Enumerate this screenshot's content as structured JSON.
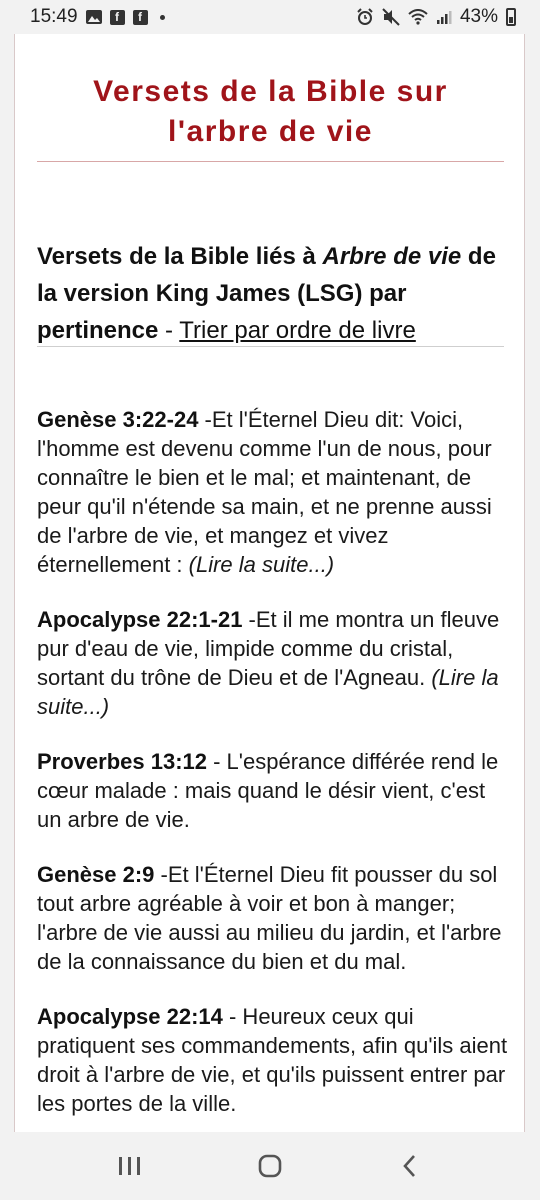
{
  "status_bar": {
    "time": "15:49",
    "battery": "43%",
    "left_icons": [
      "image-icon",
      "facebook-icon",
      "facebook-icon",
      "dot-icon"
    ],
    "right_icons": [
      "alarm-icon",
      "mute-icon",
      "wifi-icon",
      "signal-icon",
      "battery-icon"
    ]
  },
  "page": {
    "title_line1": "Versets de la Bible sur",
    "title_line2": "l'arbre de vie",
    "subhead": {
      "part1": "Versets de la Bible liés à ",
      "topic": "Arbre de vie",
      "part2": " de la version King James (LSG) par pertinence",
      "sep": " - ",
      "sort_link": "Trier par ordre de livre"
    }
  },
  "verses": [
    {
      "ref": "Genèse 3:22-24",
      "text": " -Et l'Éternel Dieu dit: Voici, l'homme est devenu comme l'un de nous, pour connaître le bien et le mal; et maintenant, de peur qu'il n'étende sa main, et ne prenne aussi de l'arbre de vie, et mangez et vivez éternellement :   ",
      "more": "(Lire la suite...)"
    },
    {
      "ref": "Apocalypse 22:1-21",
      "text": " -Et il me montra un fleuve pur d'eau de vie, limpide comme du cristal, sortant du trône de Dieu et de l'Agneau.   ",
      "more": "(Lire la suite...)"
    },
    {
      "ref": "Proverbes 13:12",
      "text": " - L'espérance différée rend le cœur malade : mais quand le désir vient, c'est un arbre de vie.",
      "more": ""
    },
    {
      "ref": "Genèse 2:9",
      "text": " -Et l'Éternel Dieu fit pousser du sol tout arbre agréable à voir et bon à manger; l'arbre de vie aussi au milieu du jardin, et l'arbre de la connaissance du bien et du mal.",
      "more": ""
    },
    {
      "ref": "Apocalypse 22:14",
      "text": " - Heureux ceux qui pratiquent ses commandements, afin qu'ils aient droit à l'arbre de vie, et qu'ils puissent entrer par les portes de la ville.",
      "more": ""
    }
  ],
  "nav_bar": {
    "buttons": [
      "recent-apps-icon",
      "home-icon",
      "back-icon"
    ]
  },
  "colors": {
    "title": "#a0141a",
    "background": "#f2f2f2",
    "card": "#ffffff"
  }
}
